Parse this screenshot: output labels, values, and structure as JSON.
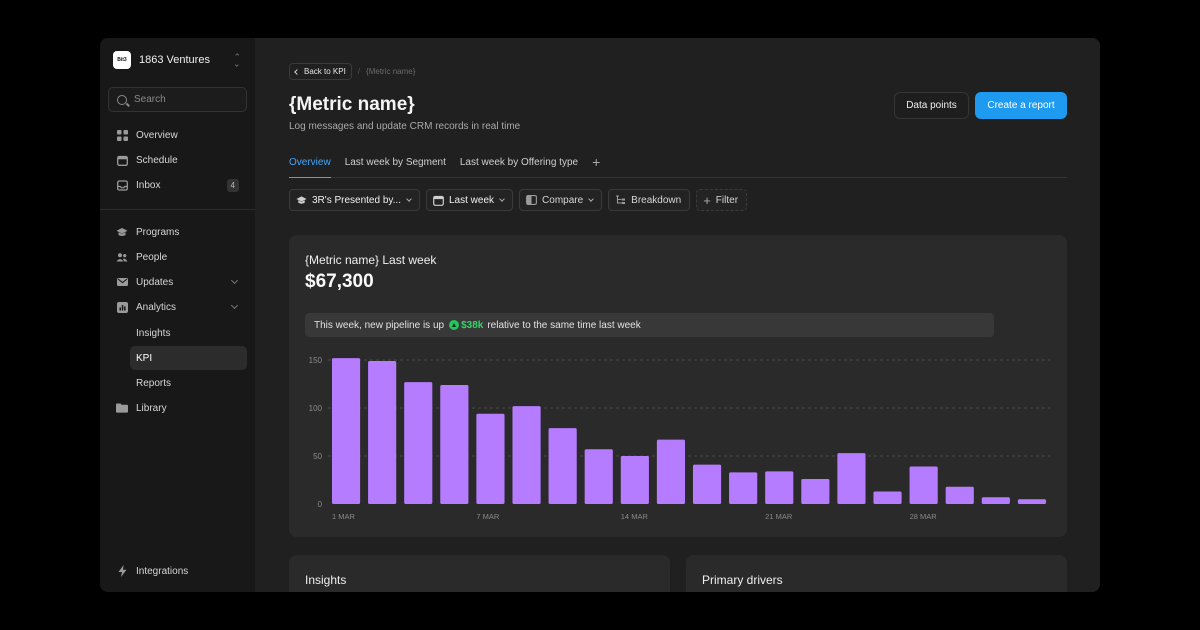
{
  "sidebar": {
    "org_name": "1863 Ventures",
    "org_logo_text": "Bit3",
    "search_placeholder": "Search",
    "items_top": [
      {
        "label": "Overview",
        "icon": "grid-icon"
      },
      {
        "label": "Schedule",
        "icon": "calendar-icon"
      },
      {
        "label": "Inbox",
        "icon": "inbox-icon",
        "badge": "4"
      }
    ],
    "items_mid": [
      {
        "label": "Programs",
        "icon": "graduation-cap-icon"
      },
      {
        "label": "People",
        "icon": "people-icon"
      },
      {
        "label": "Updates",
        "icon": "mail-icon",
        "expandable": true
      },
      {
        "label": "Analytics",
        "icon": "chart-icon",
        "expandable": true
      }
    ],
    "analytics_sub": [
      {
        "label": "Insights"
      },
      {
        "label": "KPI",
        "active": true
      },
      {
        "label": "Reports"
      }
    ],
    "library": {
      "label": "Library",
      "icon": "folder-icon"
    },
    "integrations": {
      "label": "Integrations",
      "icon": "bolt-icon"
    }
  },
  "header": {
    "back_label": "Back to KPI",
    "breadcrumb_current": "{Metric name}",
    "title": "{Metric name}",
    "subtitle": "Log messages and update CRM records in real time",
    "data_points_label": "Data points",
    "create_report_label": "Create a report"
  },
  "tabs": [
    {
      "label": "Overview",
      "active": true
    },
    {
      "label": "Last week by Segment"
    },
    {
      "label": "Last week by Offering type"
    }
  ],
  "filters": {
    "segment": "3R's Presented by...",
    "period": "Last week",
    "compare": "Compare",
    "breakdown": "Breakdown",
    "filter": "Filter"
  },
  "metric_card": {
    "title": "{Metric name} Last week",
    "value": "$67,300",
    "callout_prefix": "This week, new pipeline is up",
    "callout_value": "$38k",
    "callout_suffix": "relative to the same time last week"
  },
  "chart_data": {
    "type": "bar",
    "values": [
      152,
      149,
      127,
      124,
      94,
      102,
      79,
      57,
      50,
      67,
      41,
      33,
      34,
      26,
      53,
      13,
      39,
      18,
      7,
      5
    ],
    "x_tick_labels": [
      "1 MAR",
      "7 MAR",
      "14 MAR",
      "21 MAR",
      "28 MAR"
    ],
    "x_tick_positions": [
      0,
      4,
      8,
      12,
      16
    ],
    "y_ticks": [
      0,
      50,
      100,
      150
    ],
    "ylim": [
      0,
      150
    ],
    "bar_color": "#b57cff",
    "grid": "dashed horizontal"
  },
  "bottom_cards": {
    "insights_title": "Insights",
    "drivers_title": "Primary drivers"
  }
}
